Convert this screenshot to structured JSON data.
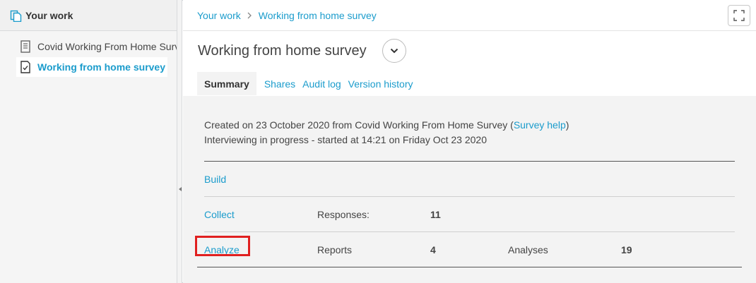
{
  "sidebar": {
    "title": "Your work",
    "items": [
      {
        "label": "Covid Working From Home Survey",
        "selected": false
      },
      {
        "label": "Working from home survey",
        "selected": true
      }
    ]
  },
  "breadcrumb": [
    "Your work",
    "Working from home survey"
  ],
  "page": {
    "title": "Working from home survey",
    "tabs": [
      "Summary",
      "Shares",
      "Audit log",
      "Version history"
    ]
  },
  "summary": {
    "created_prefix": "Created on 23 October 2020 from Covid Working From Home Survey (",
    "survey_help": "Survey help",
    "created_suffix": ")",
    "status": "Interviewing in progress - started at 14:21 on Friday Oct 23 2020"
  },
  "rows": {
    "build": "Build",
    "collect": "Collect",
    "responses_label": "Responses:",
    "responses_value": "11",
    "analyze": "Analyze",
    "reports_label": "Reports",
    "reports_value": "4",
    "analyses_label": "Analyses",
    "analyses_value": "19"
  },
  "colors": {
    "accent": "#1b9ccc",
    "highlight": "#e02020"
  }
}
